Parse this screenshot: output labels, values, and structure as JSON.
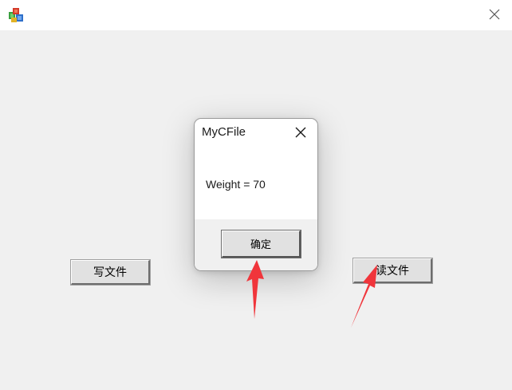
{
  "window": {
    "icon": "app-blocks-icon",
    "close_icon": "close-icon"
  },
  "main": {
    "write_button_label": "写文件",
    "read_button_label": "读文件"
  },
  "dialog": {
    "title": "MyCFile",
    "message": "Weight = 70",
    "ok_label": "确定",
    "close_icon": "close-icon"
  },
  "annotations": {
    "arrow_color": "#f0353b",
    "arrows": [
      "red-arrow-to-ok-button",
      "red-arrow-to-read-button"
    ]
  }
}
